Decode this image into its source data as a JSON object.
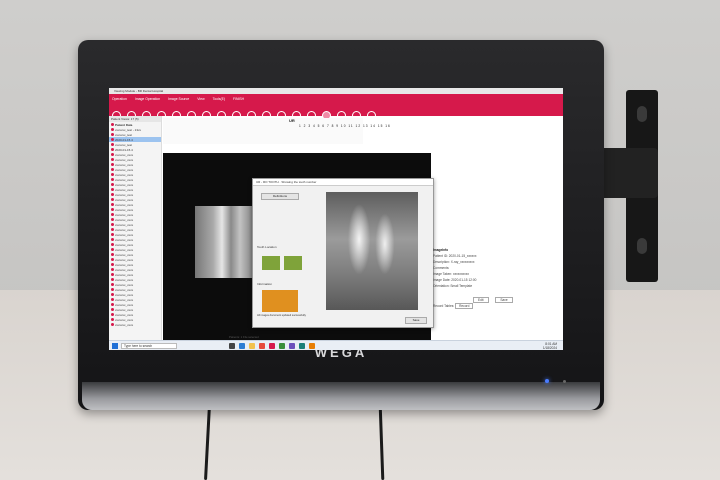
{
  "monitor": {
    "brand": "WEGA"
  },
  "app": {
    "title": "Viewing Module - BR Dental Hospital",
    "menu": [
      "Operation",
      "Image Operation",
      "Image Source",
      "View",
      "Tools(E)",
      "FINISH"
    ],
    "numbers_row": "1 2 3 4 5 6 7 8 9 10 11 12 13 14 15 16",
    "view_label": "UR"
  },
  "tree": {
    "header": "Patient Views: 17 (5)",
    "root": "Patient Data",
    "items": [
      "xxxxxxx_test - 13xx",
      "xxxxxxx_test",
      "2020-01-15.4",
      "xxxxxxx_test",
      "2020-01-15.4",
      "xxxxxxx_xxxx",
      "xxxxxxx_xxxx",
      "xxxxxxx_xxxx",
      "xxxxxxx_xxxx",
      "xxxxxxx_xxxx",
      "xxxxxxx_xxxx",
      "xxxxxxx_xxxx",
      "xxxxxxx_xxxx",
      "xxxxxxx_xxxx",
      "xxxxxxx_xxxx",
      "xxxxxxx_xxxx",
      "xxxxxxx_xxxx",
      "xxxxxxx_xxxx",
      "xxxxxxx_xxxx",
      "xxxxxxx_xxxx",
      "xxxxxxx_xxxx",
      "xxxxxxx_xxxx",
      "xxxxxxx_xxxx",
      "xxxxxxx_xxxx",
      "xxxxxxx_xxxx",
      "xxxxxxx_xxxx",
      "xxxxxxx_xxxx",
      "xxxxxxx_xxxx",
      "xxxxxxx_xxxx",
      "xxxxxxx_xxxx",
      "xxxxxxx_xxxx",
      "xxxxxxx_xxxx",
      "xxxxxxx_xxxx",
      "xxxxxxx_xxxx",
      "xxxxxxx_xxxx",
      "xxxxxxx_xxxx",
      "xxxxxxx_xxxx",
      "xxxxxxx_xxxx",
      "xxxxxxx_xxxx",
      "xxxxxxx_xxxx"
    ]
  },
  "dialog": {
    "title": "UR - RO TOOTH · Showing the tooth number",
    "top_button": "Definitions",
    "section_tooth": "Tooth Location",
    "section_info": "Information",
    "orange_note": "All images document updated successfully",
    "save_button": "Save"
  },
  "right_panel": {
    "title": "ImageInfo",
    "rows": [
      {
        "k": "Patient ID:",
        "v": "2020-01-15_xxxxxx"
      },
      {
        "k": "Description:",
        "v": "X-ray_xxxxxxxxx"
      },
      {
        "k": "Comments:",
        "v": ""
      },
      {
        "k": "Image Taken:",
        "v": "xxxxxxxxxx"
      },
      {
        "k": "Image Date:",
        "v": "2020-01-15 12:00"
      },
      {
        "k": "Orientation:",
        "v": "Small Template"
      }
    ],
    "edit_button": "Edit",
    "save_button": "Save",
    "record_label": "Record Tables:",
    "record_button": "Record"
  },
  "taskbar": {
    "search_placeholder": "Type here to search",
    "time": "8:01 AM",
    "date": "1/18/2024",
    "status": "Patients: 1  File selected"
  },
  "colors": {
    "menubar": "#d6194b",
    "tooth_green": "#7fa33a",
    "info_orange": "#e0901f",
    "selection_blue": "#9cc3ef"
  }
}
